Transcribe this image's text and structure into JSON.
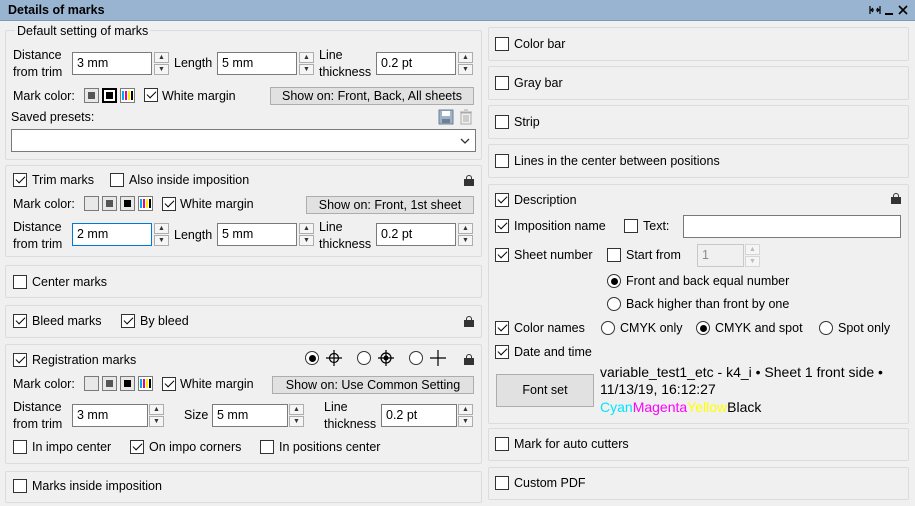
{
  "window": {
    "title": "Details of marks",
    "controls": [
      "dock-icon",
      "minimize-icon",
      "close-icon"
    ]
  },
  "default_settings": {
    "group_label": "Default setting of marks",
    "distance_label_1": "Distance",
    "distance_label_2": "from trim",
    "distance_value": "3 mm",
    "length_label": "Length",
    "length_value": "5 mm",
    "line_label_1": "Line",
    "line_label_2": "thickness",
    "line_value": "0.2 pt",
    "mark_color_label": "Mark color:",
    "white_margin_label": "White margin",
    "white_margin_checked": true,
    "show_on_label": "Show on: Front, Back, All sheets",
    "saved_presets_label": "Saved presets:",
    "saved_presets_value": ""
  },
  "trim_marks": {
    "label": "Trim marks",
    "checked": true,
    "also_inside_label": "Also inside imposition",
    "also_inside_checked": false,
    "mark_color_label": "Mark color:",
    "white_margin_label": "White margin",
    "white_margin_checked": true,
    "show_on_label": "Show on: Front, 1st sheet",
    "distance_label_1": "Distance",
    "distance_label_2": "from trim",
    "distance_value": "2 mm",
    "length_label": "Length",
    "length_value": "5 mm",
    "line_label_1": "Line",
    "line_label_2": "thickness",
    "line_value": "0.2 pt"
  },
  "center_marks": {
    "label": "Center marks",
    "checked": false
  },
  "bleed_marks": {
    "label": "Bleed marks",
    "checked": true,
    "by_bleed_label": "By bleed",
    "by_bleed_checked": true
  },
  "registration_marks": {
    "label": "Registration marks",
    "checked": true,
    "mark_color_label": "Mark color:",
    "white_margin_label": "White margin",
    "white_margin_checked": true,
    "show_on_label": "Show on: Use Common Setting",
    "distance_label_1": "Distance",
    "distance_label_2": "from trim",
    "distance_value": "3 mm",
    "size_label": "Size",
    "size_value": "5 mm",
    "line_label_1": "Line",
    "line_label_2": "thickness",
    "line_value": "0.2 pt",
    "in_impo_center_label": "In impo center",
    "in_impo_center_checked": false,
    "on_impo_corners_label": "On impo corners",
    "on_impo_corners_checked": true,
    "in_positions_center_label": "In positions center",
    "in_positions_center_checked": false
  },
  "marks_inside_imposition": {
    "label": "Marks inside imposition",
    "checked": false
  },
  "right": {
    "color_bar": {
      "label": "Color bar",
      "checked": false
    },
    "gray_bar": {
      "label": "Gray bar",
      "checked": false
    },
    "strip": {
      "label": "Strip",
      "checked": false
    },
    "lines_center": {
      "label": "Lines in the center between positions",
      "checked": false
    },
    "description": {
      "label": "Description",
      "checked": true,
      "imposition_name_label": "Imposition name",
      "imposition_name_checked": true,
      "text_label": "Text:",
      "text_checked": false,
      "text_value": "",
      "sheet_number_label": "Sheet number",
      "sheet_number_checked": true,
      "start_from_label": "Start from",
      "start_from_checked": false,
      "start_from_value": "1",
      "front_back_equal_label": "Front and back equal number",
      "back_higher_label": "Back higher than front by one",
      "color_names_label": "Color names",
      "color_names_checked": true,
      "cmyk_only_label": "CMYK only",
      "cmyk_spot_label": "CMYK and spot",
      "spot_only_label": "Spot only",
      "date_time_label": "Date and time",
      "date_time_checked": true,
      "font_set_label": "Font set",
      "preview_line1": "variable_test1_etc - k4_i • Sheet 1 front side •",
      "preview_line2": "11/13/19, 16:12:27",
      "preview_cyan": "Cyan",
      "preview_magenta": "Magenta",
      "preview_yellow": "Yellow",
      "preview_black": "Black",
      "colors": {
        "cyan": "#00e5ff",
        "magenta": "#ff00ff",
        "yellow": "#ffff00",
        "black": "#000000"
      }
    },
    "auto_cutters": {
      "label": "Mark for auto cutters",
      "checked": false
    },
    "custom_pdf": {
      "label": "Custom PDF",
      "checked": false
    }
  },
  "colors": {
    "titlebar": "#99b4d1",
    "focus": "#0078d7"
  }
}
